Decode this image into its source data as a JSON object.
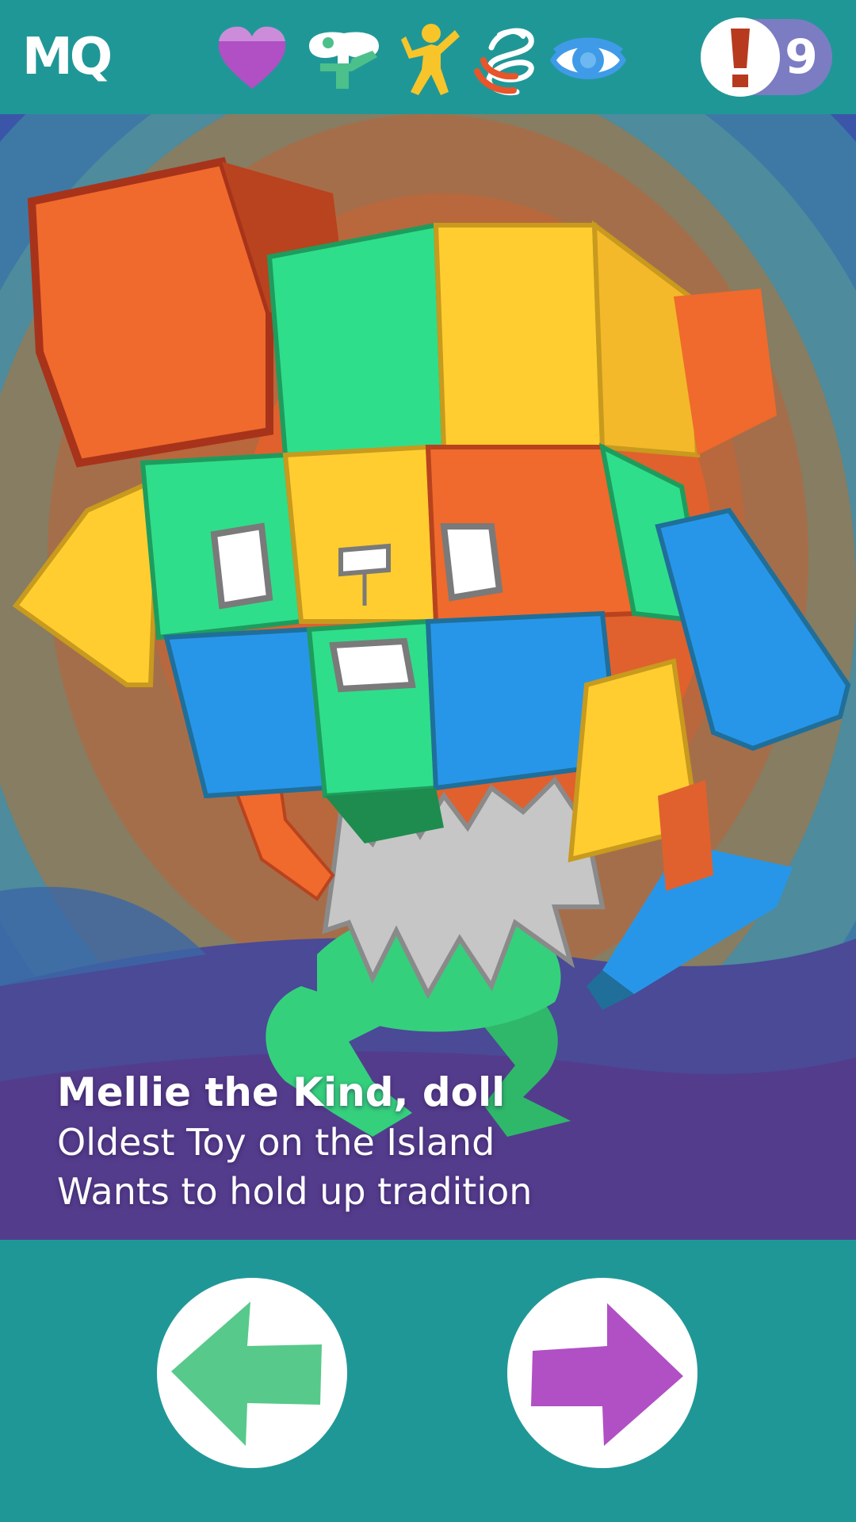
{
  "app": {
    "logo": "MQ"
  },
  "stats": [
    {
      "icon": "heart-icon",
      "color": "#b14fc5"
    },
    {
      "icon": "wind-up-key-icon",
      "color": "#4cc08a"
    },
    {
      "icon": "cheering-person-icon",
      "color": "#f7c52a"
    },
    {
      "icon": "scribble-swirl-icon",
      "color": "#e8552a"
    },
    {
      "icon": "eye-icon",
      "color": "#3f9be8"
    }
  ],
  "alert": {
    "icon": "exclamation-icon",
    "count": "9",
    "color": "#b83a1e"
  },
  "character": {
    "name": "Mellie the Kind, doll",
    "line1": "Oldest Toy on the Island",
    "line2": "Wants to hold up tradition"
  },
  "navigation": {
    "prev": {
      "icon": "arrow-left-icon",
      "color": "#57c98a"
    },
    "next": {
      "icon": "arrow-right-icon",
      "color": "#b14fc5"
    }
  }
}
